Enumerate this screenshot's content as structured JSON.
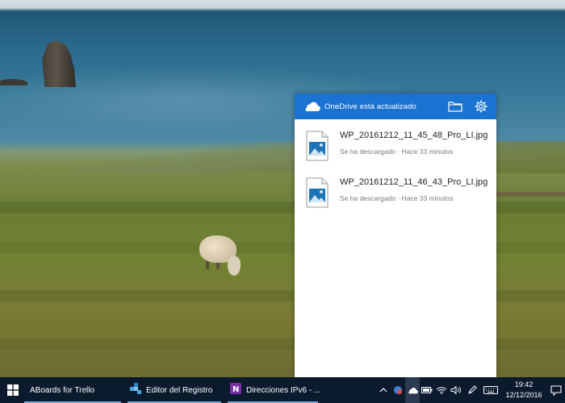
{
  "onedrive": {
    "status_title": "OneDrive está actualizado",
    "files": [
      {
        "name": "WP_20161212_11_45_48_Pro_LI.jpg",
        "status": "Se ha descargado · Hace 33 minutos"
      },
      {
        "name": "WP_20161212_11_46_43_Pro_LI.jpg",
        "status": "Se ha descargado · Hace 33 minutos"
      }
    ],
    "accent_color": "#1a73d1"
  },
  "taskbar": {
    "apps": [
      {
        "label": "ABoards for Trello",
        "icon": "aboards-icon"
      },
      {
        "label": "Editor del Registro",
        "icon": "registry-editor-icon"
      },
      {
        "label": "Direcciones IPv6 - ...",
        "icon": "onenote-icon"
      }
    ],
    "clock": {
      "time": "19:42",
      "date": "12/12/2016"
    },
    "tray_icons": [
      "chevron-up-icon",
      "security-icon",
      "onedrive-icon",
      "battery-icon",
      "wifi-icon",
      "volume-icon",
      "pen-icon",
      "keyboard-icon"
    ]
  }
}
